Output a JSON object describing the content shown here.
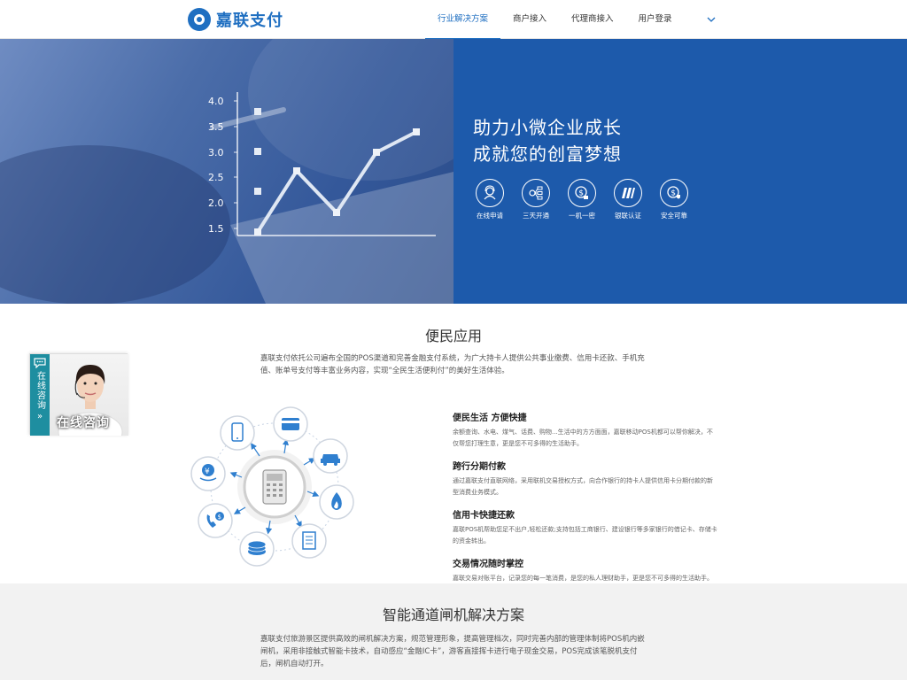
{
  "brand": {
    "name": "嘉联支付",
    "color": "#1f6fc1"
  },
  "nav": {
    "items": [
      {
        "label": "行业解决方案",
        "active": true
      },
      {
        "label": "商户接入",
        "active": false
      },
      {
        "label": "代理商接入",
        "active": false
      },
      {
        "label": "用户登录",
        "active": false
      }
    ]
  },
  "banner": {
    "chart_axis": [
      "4.0",
      "3.5",
      "3.0",
      "2.5",
      "2.0",
      "1.5"
    ],
    "slogan_line1": "助力小微企业成长",
    "slogan_line2": "成就您的创富梦想",
    "features": [
      {
        "icon": "user-headset-icon",
        "label": "在线申请"
      },
      {
        "icon": "network-icon",
        "label": "三天开通"
      },
      {
        "icon": "lock-coin-icon",
        "label": "一机一密"
      },
      {
        "icon": "unionpay-icon",
        "label": "银联认证"
      },
      {
        "icon": "shield-coin-icon",
        "label": "安全可靠"
      }
    ]
  },
  "section1": {
    "title": "便民应用",
    "description": "嘉联支付依托公司遍布全国的POS渠道和完善金融支付系统，为广大持卡人提供公共事业缴费、信用卡还款、手机充值、账单号支付等丰富业务内容，实现“全民生活便利付”的美好生活体验。",
    "items": [
      {
        "title": "便民生活 方便快捷",
        "text": "余额查询、水电、煤气、话费、购物...生活中的方方面面，嘉联移动POS机都可以帮你解决，不仅帮您打理生意，更是您不可多得的生活助手。"
      },
      {
        "title": "跨行分期付款",
        "text": "通过嘉联支付直联网络，采用联机交易授权方式，向合作银行的持卡人提供信用卡分期付款的新型消费业务模式。"
      },
      {
        "title": "信用卡快捷还款",
        "text": "嘉联POS机帮助您足不出户,轻松还款;支持包括工商银行、建设银行等多家银行的借记卡、存储卡的资金转出。"
      },
      {
        "title": "交易情况随时掌控",
        "text": "嘉联交易对账平台，记录您的每一笔消费，是您的私人理财助手，更是您不可多得的生活助手。"
      }
    ]
  },
  "chat": {
    "label": "在线咨询",
    "caption": "在线咨询"
  },
  "section2": {
    "title": "智能通道闸机解决方案",
    "description": "嘉联支付旅游景区提供高效的闸机解决方案，规范管理形象，提高管理档次，同时完善内部的管理体制将POS机内嵌闸机，采用非接触式智能卡技术，自动感应“金融IC卡”，游客直接挥卡进行电子现金交易，POS完成该笔脱机支付后，闸机自动打开。"
  }
}
